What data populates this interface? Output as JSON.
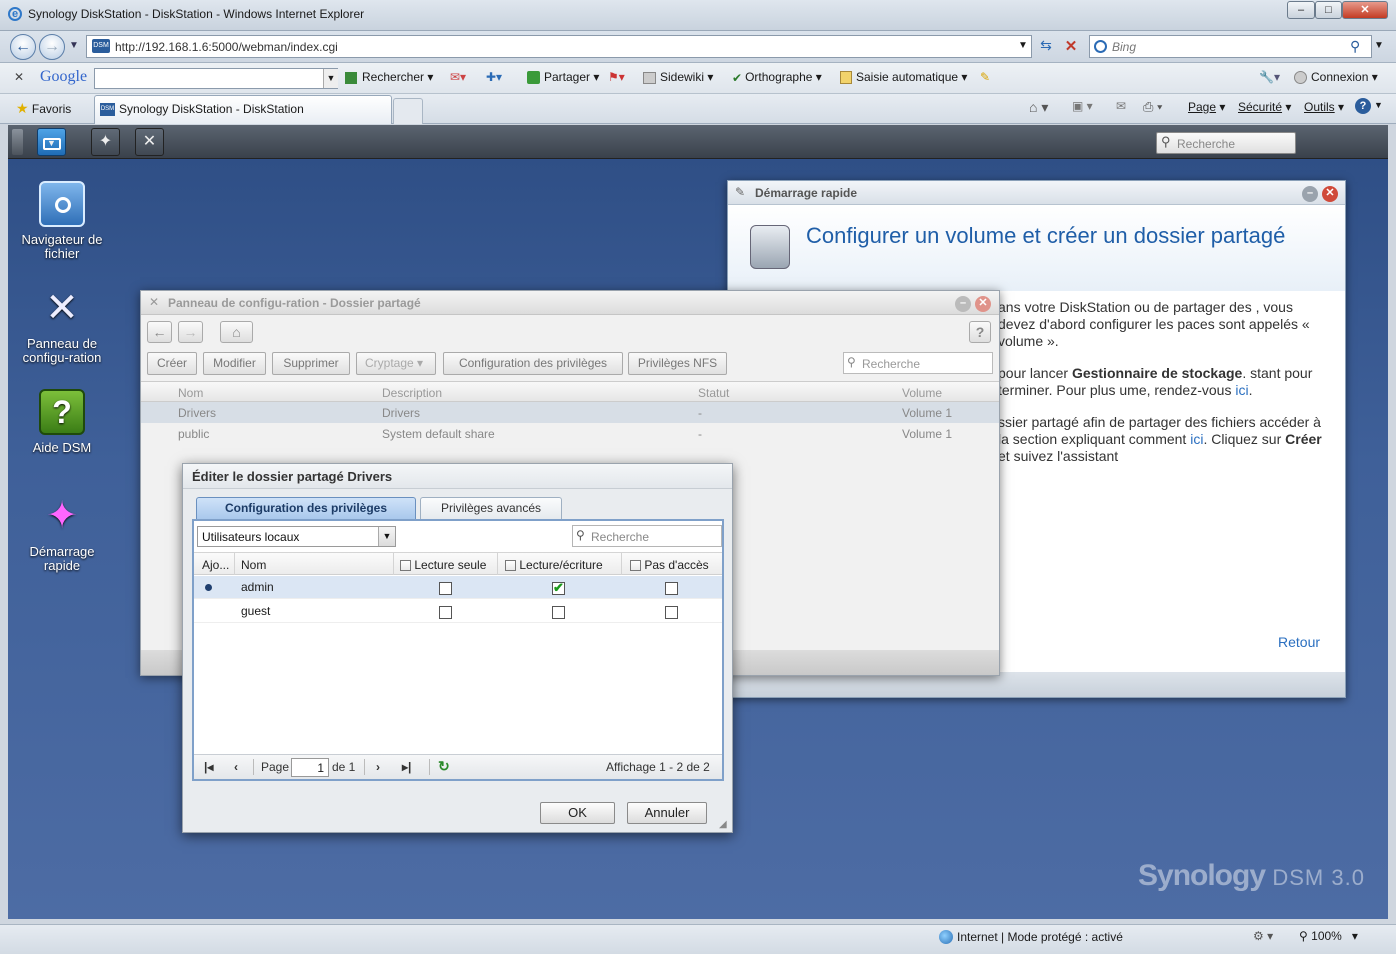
{
  "browser": {
    "window_title": "Synology DiskStation - DiskStation - Windows Internet Explorer",
    "url": "http://192.168.1.6:5000/webman/index.cgi",
    "search_provider": "Bing",
    "tab_title": "Synology DiskStation - DiskStation",
    "favorites_label": "Favoris",
    "google_toolbar": {
      "logo": "Google",
      "items": [
        "Rechercher",
        "Partager",
        "Sidewiki",
        "Orthographe",
        "Saisie automatique"
      ],
      "connexion": "Connexion"
    },
    "command_bar": [
      "Page",
      "Sécurité",
      "Outils"
    ],
    "status": {
      "zone": "Internet | Mode protégé : activé",
      "zoom": "100%"
    }
  },
  "dsm": {
    "taskbar_search_placeholder": "Recherche",
    "desktop_icons": [
      {
        "label": "Navigateur de fichier",
        "icon": "folder-search-icon"
      },
      {
        "label": "Panneau de configu-ration",
        "icon": "tools-icon"
      },
      {
        "label": "Aide DSM",
        "icon": "help-icon"
      },
      {
        "label": "Démarrage rapide",
        "icon": "magic-wand-icon"
      }
    ],
    "brand": {
      "name": "Synology",
      "product": "DSM 3.0"
    }
  },
  "quickstart": {
    "title": "Démarrage rapide",
    "heading": "Configurer un volume et créer un dossier partagé",
    "para1": "ans votre DiskStation ou de partager des , vous devez d'abord configurer les paces sont appelés « volume ».",
    "para2_pre": "pour lancer ",
    "para2_bold": "Gestionnaire de stockage",
    "para2_post": ". stant pour terminer. Pour plus ume, rendez-vous ",
    "link_ici": "ici",
    "para3_pre": "ssier partagé afin de partager des fichiers accéder à la section expliquant comment ",
    "para3_mid": ". Cliquez sur ",
    "para3_bold": "Créer",
    "para3_post": " et suivez l'assistant",
    "back": "Retour"
  },
  "control_panel": {
    "title": "Panneau de configu-ration - Dossier partagé",
    "toolbar": [
      "Créer",
      "Modifier",
      "Supprimer",
      "Cryptage",
      "Configuration des privilèges",
      "Privilèges NFS"
    ],
    "search_placeholder": "Recherche",
    "columns": [
      "Nom",
      "Description",
      "Statut",
      "Volume"
    ],
    "rows": [
      {
        "name": "Drivers",
        "description": "Drivers",
        "status": "-",
        "volume": "Volume 1"
      },
      {
        "name": "public",
        "description": "System default share",
        "status": "-",
        "volume": "Volume 1"
      }
    ]
  },
  "edit_dialog": {
    "title": "Éditer le dossier partagé Drivers",
    "tabs": [
      "Configuration des privilèges",
      "Privilèges avancés"
    ],
    "user_filter": "Utilisateurs locaux",
    "search_placeholder": "Recherche",
    "columns": [
      "Ajo...",
      "Nom",
      "Lecture seule",
      "Lecture/écriture",
      "Pas d'accès"
    ],
    "rows": [
      {
        "name": "admin",
        "read_only": false,
        "read_write": true,
        "no_access": false,
        "added": true
      },
      {
        "name": "guest",
        "read_only": false,
        "read_write": false,
        "no_access": false,
        "added": false
      }
    ],
    "pager": {
      "page_label": "Page",
      "page": "1",
      "of": "de 1",
      "display": "Affichage 1 - 2 de 2"
    },
    "ok": "OK",
    "cancel": "Annuler"
  }
}
